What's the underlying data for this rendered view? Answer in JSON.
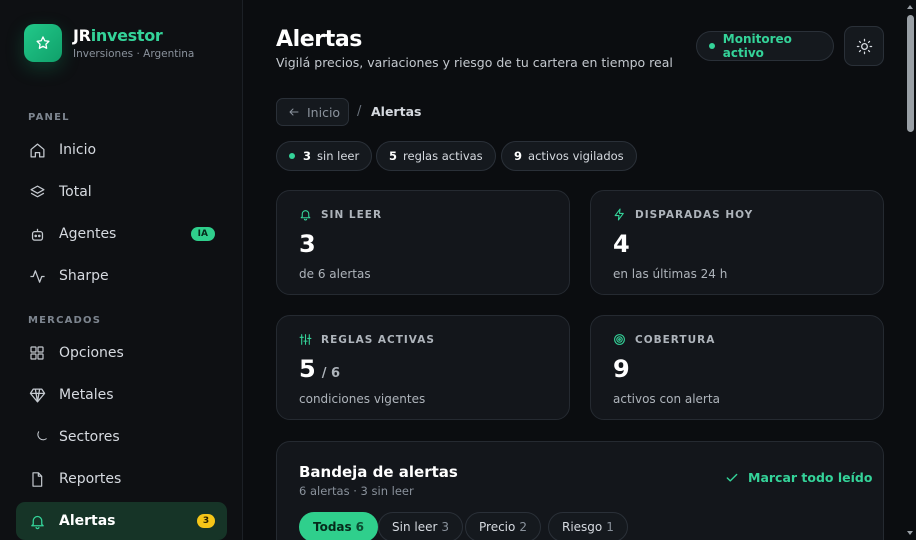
{
  "brand": {
    "name_a": "JR",
    "name_b": "investor",
    "subtitle": "Inversiones · Argentina",
    "icon": "star-icon"
  },
  "sidebar": {
    "section_panel": "PANEL",
    "section_markets": "MERCADOS",
    "items": [
      {
        "label": "Inicio",
        "icon": "home-icon"
      },
      {
        "label": "Total",
        "icon": "layers-icon"
      },
      {
        "label": "Agentes",
        "icon": "robot-icon",
        "badge": "IA"
      },
      {
        "label": "Sharpe",
        "icon": "activity-icon"
      },
      {
        "label": "Opciones",
        "icon": "grid-icon"
      },
      {
        "label": "Metales",
        "icon": "diamond-icon"
      },
      {
        "label": "Sectores",
        "icon": "moon-icon"
      },
      {
        "label": "Reportes",
        "icon": "file-icon"
      },
      {
        "label": "Alertas",
        "icon": "bell-icon",
        "badge": "3",
        "active": true
      }
    ]
  },
  "header": {
    "title": "Alertas",
    "subtitle": "Vigilá precios, variaciones y riesgo de tu cartera en tiempo real",
    "status": "Monitoreo activo",
    "theme_icon": "sun-icon"
  },
  "breadcrumb": {
    "back": "Inicio",
    "separator": "/",
    "current": "Alertas"
  },
  "chips": [
    {
      "value": "3",
      "label": "sin leer"
    },
    {
      "value": "5",
      "label": "reglas activas"
    },
    {
      "value": "9",
      "label": "activos vigilados"
    }
  ],
  "cards": [
    {
      "title": "SIN LEER",
      "value": "3",
      "desc": "de 6 alertas",
      "icon": "bell-icon"
    },
    {
      "title": "DISPARADAS HOY",
      "value": "4",
      "desc": "en las últimas 24 h",
      "icon": "zap-icon"
    },
    {
      "title": "REGLAS ACTIVAS",
      "value": "5",
      "of": "/ 6",
      "desc": "condiciones vigentes",
      "icon": "sliders-icon"
    },
    {
      "title": "COBERTURA",
      "value": "9",
      "desc": "activos con alerta",
      "icon": "target-icon"
    }
  ],
  "inbox": {
    "title": "Bandeja de alertas",
    "subtitle": "6 alertas · 3 sin leer",
    "mark_all": "Marcar todo leído",
    "tabs": [
      {
        "label": "Todas",
        "count": "6",
        "active": true
      },
      {
        "label": "Sin leer",
        "count": "3"
      },
      {
        "label": "Precio",
        "count": "2"
      },
      {
        "label": "Riesgo",
        "count": "1"
      }
    ]
  },
  "colors": {
    "accent": "#34d399",
    "badge_yellow": "#f5c518",
    "bg": "#0b0d10",
    "card": "#13161b"
  }
}
